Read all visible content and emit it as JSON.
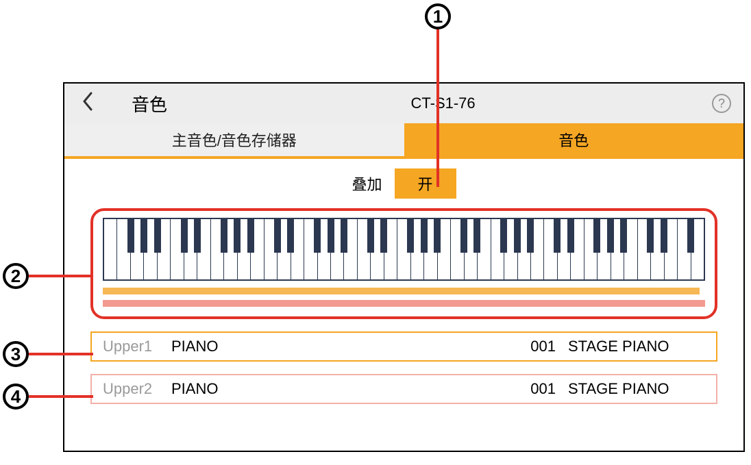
{
  "callouts": {
    "c1": "1",
    "c2": "2",
    "c3": "3",
    "c4": "4"
  },
  "header": {
    "title": "音色",
    "model": "CT-S1-76"
  },
  "tabs": {
    "left": "主音色/音色存储器",
    "right": "音色"
  },
  "layer": {
    "label": "叠加",
    "value": "开"
  },
  "parts": {
    "upper1": {
      "part": "Upper1",
      "category": "PIANO",
      "number": "001",
      "name": "STAGE PIANO"
    },
    "upper2": {
      "part": "Upper2",
      "category": "PIANO",
      "number": "001",
      "name": "STAGE PIANO"
    }
  }
}
